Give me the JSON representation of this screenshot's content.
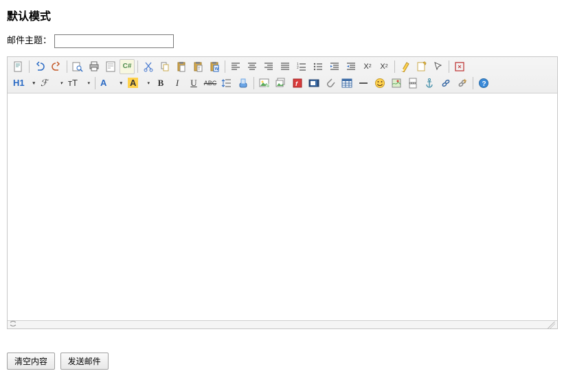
{
  "title": "默认模式",
  "subject_label": "邮件主题：",
  "subject_value": "",
  "buttons": {
    "clear": "清空内容",
    "send": "发送邮件"
  },
  "toolbar": {
    "source": "源码",
    "undo": "撤销",
    "redo": "重做",
    "preview": "预览",
    "print": "打印",
    "template": "模板",
    "code": "代码",
    "cut": "剪切",
    "copy": "复制",
    "paste": "粘贴",
    "plainpaste": "纯文本粘贴",
    "wordpaste": "Word粘贴",
    "justifyleft": "左对齐",
    "justifycenter": "居中",
    "justifyright": "右对齐",
    "justifyfull": "两端对齐",
    "orderedlist": "编号",
    "unorderedlist": "项目符号",
    "indent": "增加缩进",
    "outdent": "减少缩进",
    "subscript": "下标",
    "superscript": "上标",
    "clearformat": "清除格式",
    "quickformat": "一键排版",
    "selectall": "全选",
    "fullscreen": "全屏",
    "formatblock": "H1",
    "fontname": "ℱ",
    "fontsize": "ᴛT",
    "forecolor": "A",
    "hilitecolor": "A",
    "bold": "B",
    "italic": "I",
    "underline": "U",
    "strike": "ABC",
    "linebreak": "换行",
    "hr": "横线",
    "removeformat": "删除格式",
    "image": "图片",
    "multiimage": "多图",
    "flash": "Flash",
    "media": "视频",
    "file": "附件",
    "table": "表格",
    "pagebreak": "分页",
    "emoticons": "表情",
    "map": "地图",
    "insertcode": "插入代码",
    "anchor": "锚点",
    "link": "链接",
    "unlink": "取消链接",
    "about": "关于"
  }
}
